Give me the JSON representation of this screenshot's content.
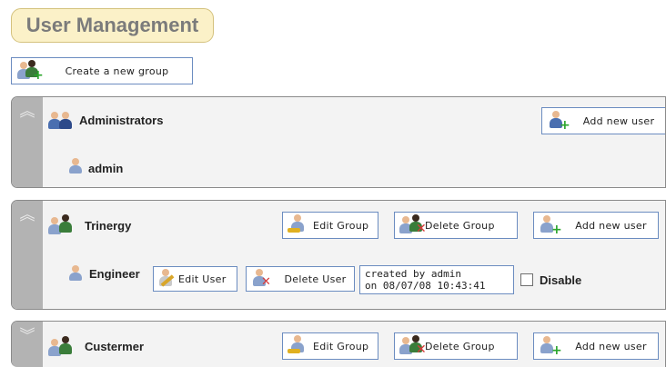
{
  "page": {
    "title": "User Management"
  },
  "toolbar": {
    "create_group_label": "Create a new group"
  },
  "groups": [
    {
      "name": "Administrators",
      "add_user_label": "Add new user",
      "users": [
        {
          "name": "admin"
        }
      ]
    },
    {
      "name": "Trinergy",
      "edit_group_label": "Edit Group",
      "delete_group_label": "Delete Group",
      "add_user_label": "Add new user",
      "users": [
        {
          "name": "Engineer",
          "edit_user_label": "Edit User",
          "delete_user_label": "Delete User",
          "info_line1": "created by admin",
          "info_line2": "on 08/07/08 10:43:41",
          "disable_label": "Disable",
          "disabled": false
        }
      ]
    },
    {
      "name": "Custermer",
      "edit_group_label": "Edit Group",
      "delete_group_label": "Delete Group",
      "add_user_label": "Add new user",
      "users": []
    }
  ],
  "icons": {
    "expanded": "chevron-up-icon",
    "collapsed": "chevron-down-icon"
  },
  "colors": {
    "title_bg": "#fbf1c8",
    "panel_bg": "#f3f3f3",
    "rail": "#b3b3b3",
    "button_border": "#6b8cc0"
  }
}
